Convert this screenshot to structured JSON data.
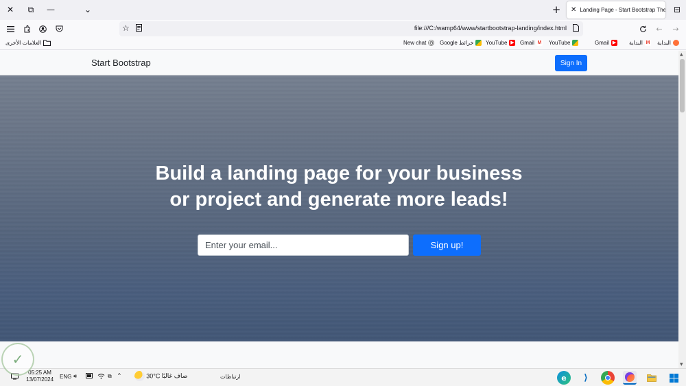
{
  "browser": {
    "tab": {
      "title": "Landing Page - Start Bootstrap The",
      "close_icon": "✕"
    },
    "controls": {
      "close": "✕",
      "restore": "⧉",
      "minimize": "—",
      "dropdown": "⌄",
      "new_tab": "+",
      "tab_overview": "⊟"
    },
    "url": "file:///C:/wamp64/www/startbootstrap-landing/index.html",
    "bookmarks": [
      {
        "label": "البداية",
        "icon": "firefox-icon"
      },
      {
        "label": "Gmail",
        "icon": "gmail-icon"
      },
      {
        "label": "YouTube",
        "icon": "youtube-icon"
      },
      {
        "label": "Google خرائط",
        "icon": "maps-icon"
      },
      {
        "label": "Gmail",
        "icon": "gmail-icon"
      },
      {
        "label": "YouTube",
        "icon": "youtube-icon"
      },
      {
        "label": "Google خرائط",
        "icon": "maps-icon"
      },
      {
        "label": "New chat",
        "icon": "chatgpt-icon"
      }
    ],
    "other_bookmarks": "العلامات الأخرى"
  },
  "site": {
    "brand": "Start Bootstrap",
    "sign_in": "Sign In",
    "hero_line1": "Build a landing page for your business",
    "hero_line2": "or project and generate more leads!",
    "email_placeholder": "Enter your email...",
    "signup": "Sign up!"
  },
  "taskbar": {
    "time": "05:25 AM",
    "date": "13/07/2024",
    "lang": "ENG",
    "temperature": "30°C",
    "weather": "صاف غالبًا",
    "links": "ارتباطات"
  },
  "colors": {
    "primary": "#0d6efd",
    "page_bg": "#f8f9fa",
    "browser_chrome": "#f0f0f4"
  }
}
